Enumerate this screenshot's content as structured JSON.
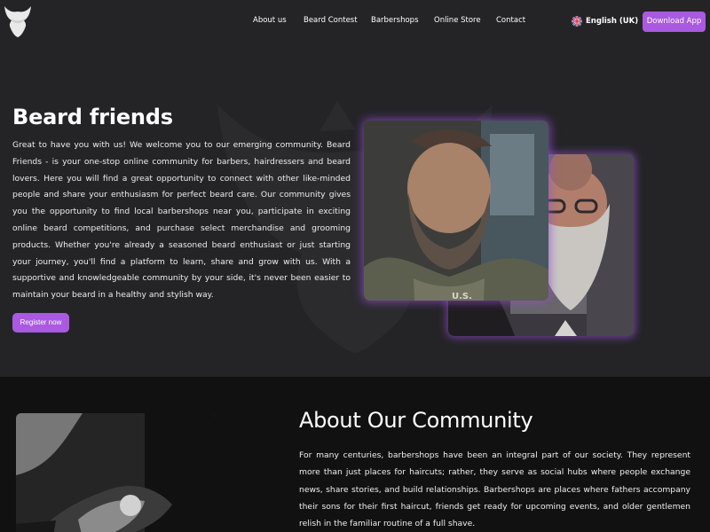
{
  "header": {
    "logo": "beard-logo",
    "nav": [
      "About us",
      "Beard Contest",
      "Barbershops",
      "Online Store",
      "Contact"
    ],
    "language": "English (UK)",
    "language_icon": "uk-flag-icon",
    "download_button": "Download App"
  },
  "hero": {
    "title": "Beard friends",
    "description": "Great to have you with us! We welcome you to our emerging community. Beard Friends - is your one-stop online community for barbers, hairdressers and beard lovers. Here you will find a great opportunity to connect with other like-minded people and share your enthusiasm for perfect beard care. Our community gives you the opportunity to find local barbershops near you, participate in exciting online beard competitions, and purchase select merchandise and grooming products. Whether you're already a seasoned beard enthusiast or just starting your journey, you'll find a platform to learn, share and grow with us. With a supportive and knowledgeable community by your side, it's never been easier to maintain your beard in a healthy and stylish way.",
    "register_button": "Register now",
    "image_front": "bearded-man-in-military-jacket",
    "image_back": "older-bearded-man-with-glasses"
  },
  "about": {
    "title": "About Our Community",
    "description": "For many centuries, barbershops have been an integral part of our society. They represent more than just places for haircuts; rather, they serve as social hubs where people exchange news, share stories, and build relationships. Barbershops are places where fathers accompany their sons for their first haircut, friends get ready for upcoming events, and older gentlemen relish in the familiar routine of a full shave.",
    "image": "man-getting-shave-black-and-white"
  },
  "colors": {
    "accent": "#a95ae0",
    "hero_bg": "#242427",
    "about_bg": "#111112"
  }
}
